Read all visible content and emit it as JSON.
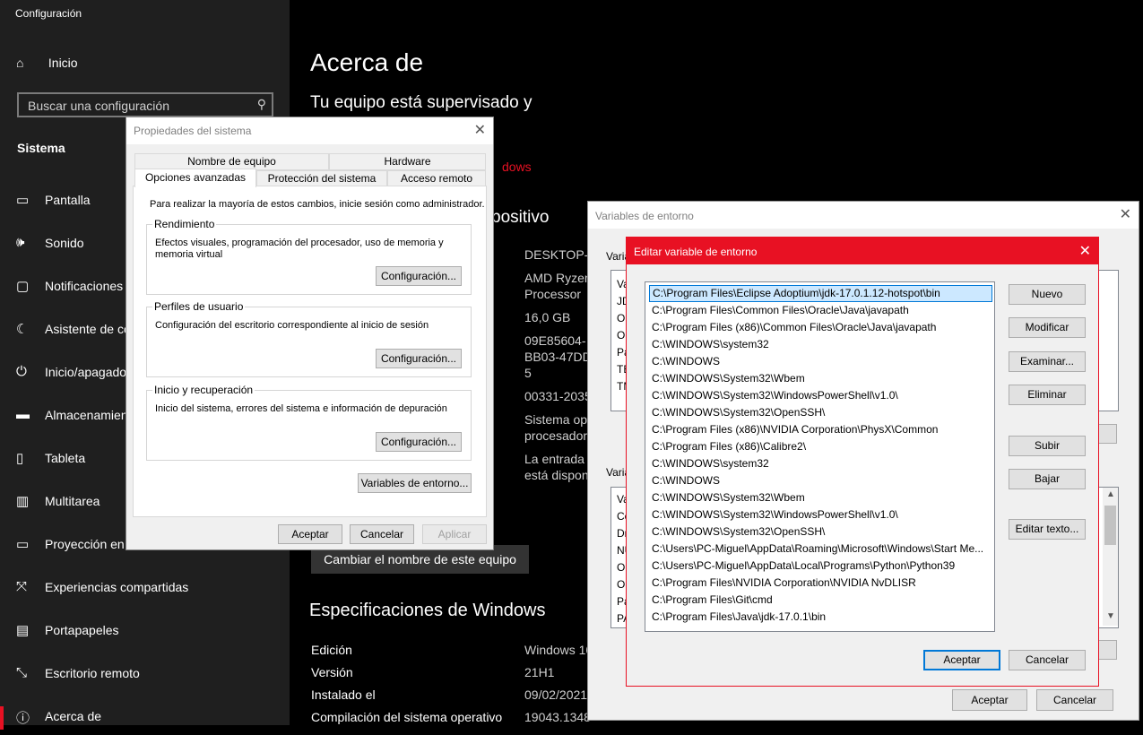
{
  "settings": {
    "app_title": "Configuración",
    "home_label": "Inicio",
    "search_placeholder": "Buscar una configuración",
    "section": "Sistema",
    "nav": [
      {
        "label": "Pantalla",
        "icon": "monitor-icon"
      },
      {
        "label": "Sonido",
        "icon": "speaker-icon"
      },
      {
        "label": "Notificaciones",
        "icon": "notification-icon"
      },
      {
        "label": "Asistente de co",
        "icon": "moon-icon"
      },
      {
        "label": "Inicio/apagado",
        "icon": "power-icon"
      },
      {
        "label": "Almacenamien",
        "icon": "storage-icon"
      },
      {
        "label": "Tableta",
        "icon": "tablet-icon"
      },
      {
        "label": "Multitarea",
        "icon": "multitask-icon"
      },
      {
        "label": "Proyección en",
        "icon": "projection-icon"
      },
      {
        "label": "Experiencias compartidas",
        "icon": "share-icon"
      },
      {
        "label": "Portapapeles",
        "icon": "clipboard-icon"
      },
      {
        "label": "Escritorio remoto",
        "icon": "remote-desktop-icon"
      },
      {
        "label": "Acerca de",
        "icon": "info-icon"
      }
    ]
  },
  "about": {
    "title": "Acerca de",
    "subtitle": "Tu equipo está supervisado y",
    "red_link": "dows",
    "device_heading": "positivo",
    "device_values": [
      "DESKTOP-F",
      "AMD Ryzen",
      "Processor",
      "16,0 GB",
      "09E85604-",
      "BB03-47DD",
      "5",
      "00331-2035",
      "Sistema op",
      "procesador",
      "La entrada",
      "está dispon"
    ],
    "rename_button": "Cambiar el nombre de este equipo",
    "specs_heading": "Especificaciones de Windows",
    "specs": [
      {
        "label": "Edición",
        "value": "Windows 10"
      },
      {
        "label": "Versión",
        "value": "21H1"
      },
      {
        "label": "Instalado el",
        "value": "09/02/2021"
      },
      {
        "label": "Compilación del sistema operativo",
        "value": "19043.1348"
      }
    ]
  },
  "sysprops": {
    "title": "Propiedades del sistema",
    "tabs_top": [
      "Nombre de equipo",
      "Hardware"
    ],
    "tabs_bottom": [
      "Opciones avanzadas",
      "Protección del sistema",
      "Acceso remoto"
    ],
    "admin_note": "Para realizar la mayoría de estos cambios, inicie sesión como administrador.",
    "groups": [
      {
        "label": "Rendimiento",
        "desc": "Efectos visuales, programación del procesador, uso de memoria y memoria virtual",
        "button": "Configuración..."
      },
      {
        "label": "Perfiles de usuario",
        "desc": "Configuración del escritorio correspondiente al inicio de sesión",
        "button": "Configuración..."
      },
      {
        "label": "Inicio y recuperación",
        "desc": "Inicio del sistema, errores del sistema e información de depuración",
        "button": "Configuración..."
      }
    ],
    "env_button": "Variables de entorno...",
    "ok": "Aceptar",
    "cancel": "Cancelar",
    "apply": "Aplicar"
  },
  "envvars": {
    "title": "Variables de entorno",
    "user_group_label": "Varia",
    "user_list": [
      "Va",
      "JD",
      "Or",
      "Or",
      "Pa",
      "TE",
      "TM"
    ],
    "system_group_label": "Varia",
    "system_list": [
      "Va",
      "Co",
      "Dr",
      "NU",
      "OI",
      "OS",
      "Pa",
      "PA"
    ],
    "ok": "Aceptar",
    "cancel": "Cancelar"
  },
  "editvar": {
    "title": "Editar variable de entorno",
    "paths": [
      "C:\\Program Files\\Eclipse Adoptium\\jdk-17.0.1.12-hotspot\\bin",
      "C:\\Program Files\\Common Files\\Oracle\\Java\\javapath",
      "C:\\Program Files (x86)\\Common Files\\Oracle\\Java\\javapath",
      "C:\\WINDOWS\\system32",
      "C:\\WINDOWS",
      "C:\\WINDOWS\\System32\\Wbem",
      "C:\\WINDOWS\\System32\\WindowsPowerShell\\v1.0\\",
      "C:\\WINDOWS\\System32\\OpenSSH\\",
      "C:\\Program Files (x86)\\NVIDIA Corporation\\PhysX\\Common",
      "C:\\Program Files (x86)\\Calibre2\\",
      "C:\\WINDOWS\\system32",
      "C:\\WINDOWS",
      "C:\\WINDOWS\\System32\\Wbem",
      "C:\\WINDOWS\\System32\\WindowsPowerShell\\v1.0\\",
      "C:\\WINDOWS\\System32\\OpenSSH\\",
      "C:\\Users\\PC-Miguel\\AppData\\Roaming\\Microsoft\\Windows\\Start Me...",
      "C:\\Users\\PC-Miguel\\AppData\\Local\\Programs\\Python\\Python39",
      "C:\\Program Files\\NVIDIA Corporation\\NVIDIA NvDLISR",
      "C:\\Program Files\\Git\\cmd",
      "C:\\Program Files\\Java\\jdk-17.0.1\\bin"
    ],
    "buttons": {
      "new": "Nuevo",
      "edit": "Modificar",
      "browse": "Examinar...",
      "delete": "Eliminar",
      "up": "Subir",
      "down": "Bajar",
      "edit_text": "Editar texto...",
      "ok": "Aceptar",
      "cancel": "Cancelar"
    }
  }
}
